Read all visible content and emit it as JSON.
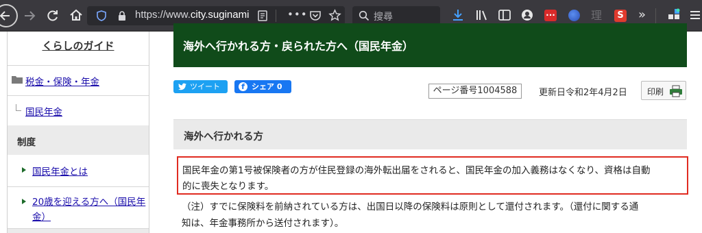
{
  "browser": {
    "url_prefix": "https://www.",
    "url_host": "city.suginami",
    "search_placeholder": "搜尋",
    "firefox_sq_label": "···",
    "ext_char": "理",
    "ext_s_label": "S"
  },
  "sidebar": {
    "title": "くらしのガイド",
    "item1": "税金・保険・年金",
    "item2": "国民年金",
    "heading": "制度",
    "link1": "国民年金とは",
    "link2_line1": "20歳を迎える方へ（国民年",
    "link2_line2": "金）"
  },
  "main": {
    "title": "海外へ行かれる方・戻られた方へ（国民年金）",
    "tweet_label": "ツイート",
    "share_label": "シェア 0",
    "page_number": "ページ番号1004588",
    "updated": "更新日令和2年4月2日",
    "print_label": "印刷",
    "section_title": "海外へ行かれる方",
    "para1_line1": "国民年金の第1号被保険者の方が住民登録の海外転出届をされると、国民年金の加入義務はなくなり、資格は自動",
    "para1_line2": "的に喪失となります。",
    "para2_line1": "（注）すでに保険料を前納されている方は、出国日以降の保険料は原則として還付されます。（還付に関する通",
    "para2_line2": "知は、年金事務所から送付されます）。"
  },
  "colors": {
    "toolbar_bg": "#3a393e",
    "header_green": "#104b1a",
    "twitter_blue": "#1da1f2",
    "facebook_blue": "#1877f2",
    "highlight_red": "#e02b20",
    "link_blue": "#1a0dab"
  },
  "icons": [
    "back-icon",
    "forward-icon",
    "reload-icon",
    "home-icon",
    "shield-icon",
    "lock-icon",
    "reader-icon",
    "more-icon",
    "pocket-icon",
    "star-icon",
    "search-icon",
    "download-icon",
    "library-icon",
    "sidebar-icon",
    "account-icon",
    "overflow-icon",
    "extensions-icon",
    "menu-icon",
    "folder-icon",
    "printer-icon"
  ]
}
